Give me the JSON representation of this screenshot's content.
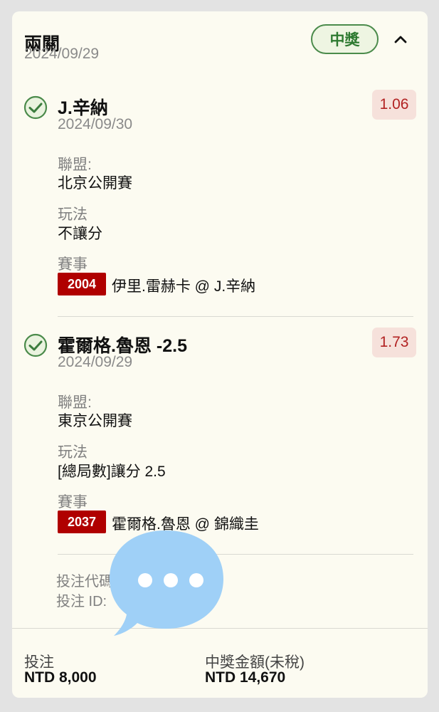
{
  "header": {
    "title": "兩關",
    "date": "2024/09/29",
    "status_badge": "中獎",
    "collapse_icon": "chevron-up-icon"
  },
  "selections": [
    {
      "title": "J.辛納",
      "date": "2024/09/30",
      "odds": "1.06",
      "league_label": "聯盟:",
      "league": "北京公開賽",
      "play_label": "玩法",
      "play": "不讓分",
      "match_label": "賽事",
      "match_code": "2004",
      "match_name": "伊里.雷赫卡 @ J.辛納",
      "status_icon": "check-circle-icon"
    },
    {
      "title": "霍爾格.魯恩 -2.5",
      "date": "2024/09/29",
      "odds": "1.73",
      "league_label": "聯盟:",
      "league": "東京公開賽",
      "play_label": "玩法",
      "play": "[總局數]讓分 2.5",
      "match_label": "賽事",
      "match_code": "2037",
      "match_name": "霍爾格.魯恩 @ 錦織圭",
      "status_icon": "check-circle-icon"
    }
  ],
  "bet_info": {
    "code_label": "投注代碼",
    "id_label": "投注 ID:"
  },
  "footer": {
    "stake_label": "投注",
    "stake_value": "NTD 8,000",
    "payout_label": "中獎金額(未稅)",
    "payout_value": "NTD 14,670"
  },
  "colors": {
    "card_bg": "#fcfbf1",
    "win_green": "#2e7a31",
    "odds_red": "#b22222",
    "code_red": "#b00000",
    "bubble_blue": "#9fd0f7"
  }
}
